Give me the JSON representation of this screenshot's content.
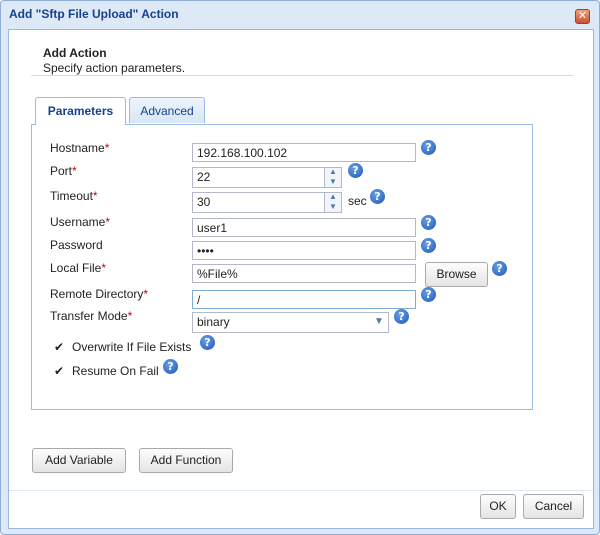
{
  "window": {
    "title": "Add \"Sftp File Upload\" Action",
    "close_symbol": "✕"
  },
  "header": {
    "title": "Add Action",
    "subtitle": "Specify action parameters."
  },
  "tabs": [
    {
      "label": "Parameters",
      "active": true
    },
    {
      "label": "Advanced",
      "active": false
    }
  ],
  "form": {
    "hostname": {
      "label": "Hostname",
      "value": "192.168.100.102"
    },
    "port": {
      "label": "Port",
      "value": "22"
    },
    "timeout": {
      "label": "Timeout",
      "value": "30",
      "unit": "sec"
    },
    "username": {
      "label": "Username",
      "value": "user1"
    },
    "password": {
      "label": "Password",
      "value": "••••"
    },
    "local_file": {
      "label": "Local File",
      "value": "%File%",
      "browse_label": "Browse"
    },
    "remote_directory": {
      "label": "Remote Directory",
      "value": "/"
    },
    "transfer_mode": {
      "label": "Transfer Mode",
      "value": "binary"
    },
    "overwrite": {
      "label": "Overwrite If File Exists",
      "checked": true
    },
    "resume": {
      "label": "Resume On Fail",
      "checked": true
    },
    "required_mark": "*",
    "help_symbol": "?",
    "check_symbol": "✔"
  },
  "actions": {
    "add_variable": "Add Variable",
    "add_function": "Add Function"
  },
  "footer": {
    "ok": "OK",
    "cancel": "Cancel"
  },
  "colors": {
    "title_text": "#15428b",
    "required": "#cc0000",
    "help_icon": "#1b56b8"
  }
}
